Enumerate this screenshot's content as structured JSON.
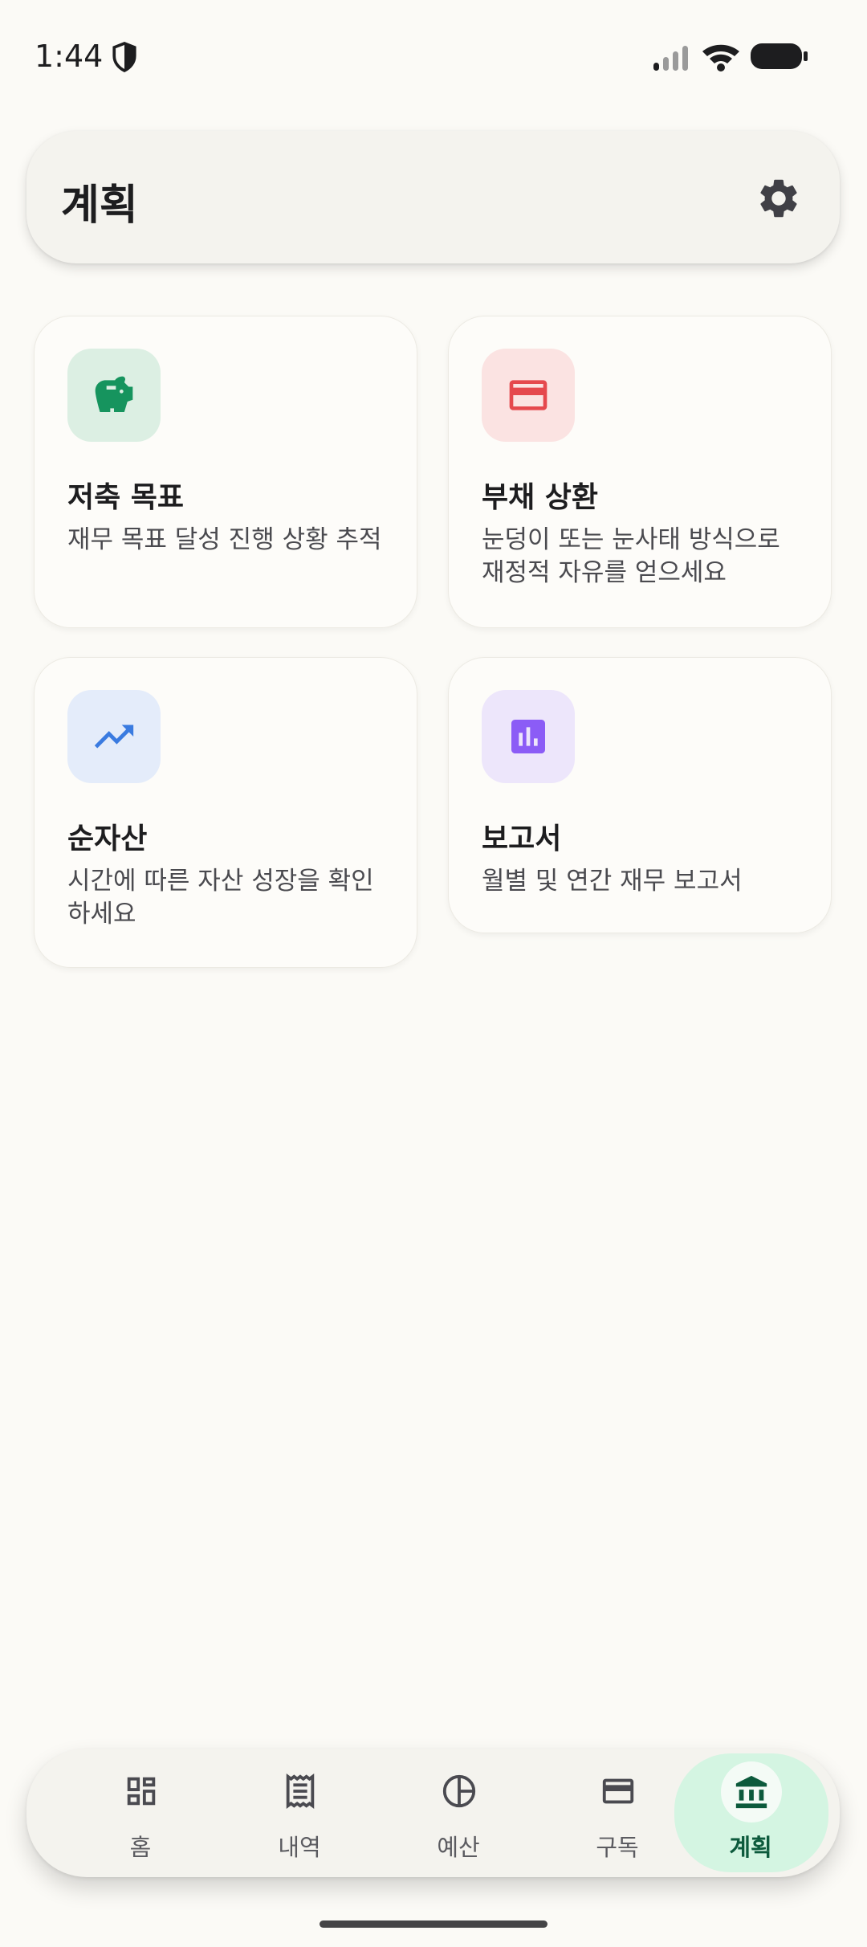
{
  "status_bar": {
    "time": "1:44"
  },
  "header": {
    "title": "계획"
  },
  "cards": {
    "savings": {
      "title": "저축 목표",
      "description": "재무 목표 달성 진행 상황 추적",
      "icon": "piggy-bank-icon",
      "icon_color": "#16945e",
      "bg_color": "#dcefe3"
    },
    "debt": {
      "title": "부채 상환",
      "description": "눈덩이 또는 눈사태 방식으로 재정적 자유를 얻으세요",
      "icon": "credit-card-icon",
      "icon_color": "#e5484d",
      "bg_color": "#fbe3e2"
    },
    "networth": {
      "title": "순자산",
      "description": "시간에 따른 자산 성장을 확인하세요",
      "icon": "trending-up-icon",
      "icon_color": "#3a7be0",
      "bg_color": "#e4ecfa"
    },
    "reports": {
      "title": "보고서",
      "description": "월별 및 연간 재무 보고서",
      "icon": "bar-chart-icon",
      "icon_color": "#8b5cf6",
      "bg_color": "#ede6fb"
    }
  },
  "bottom_nav": {
    "items": [
      {
        "label": "홈",
        "icon": "dashboard-icon"
      },
      {
        "label": "내역",
        "icon": "receipt-icon"
      },
      {
        "label": "예산",
        "icon": "pie-chart-icon"
      },
      {
        "label": "구독",
        "icon": "credit-card-icon"
      },
      {
        "label": "계획",
        "icon": "bank-icon",
        "active": true
      }
    ]
  },
  "colors": {
    "background": "#fbfaf6",
    "active_tab_bg": "#d4f5e2",
    "active_tab_fg": "#0c5a3c"
  }
}
